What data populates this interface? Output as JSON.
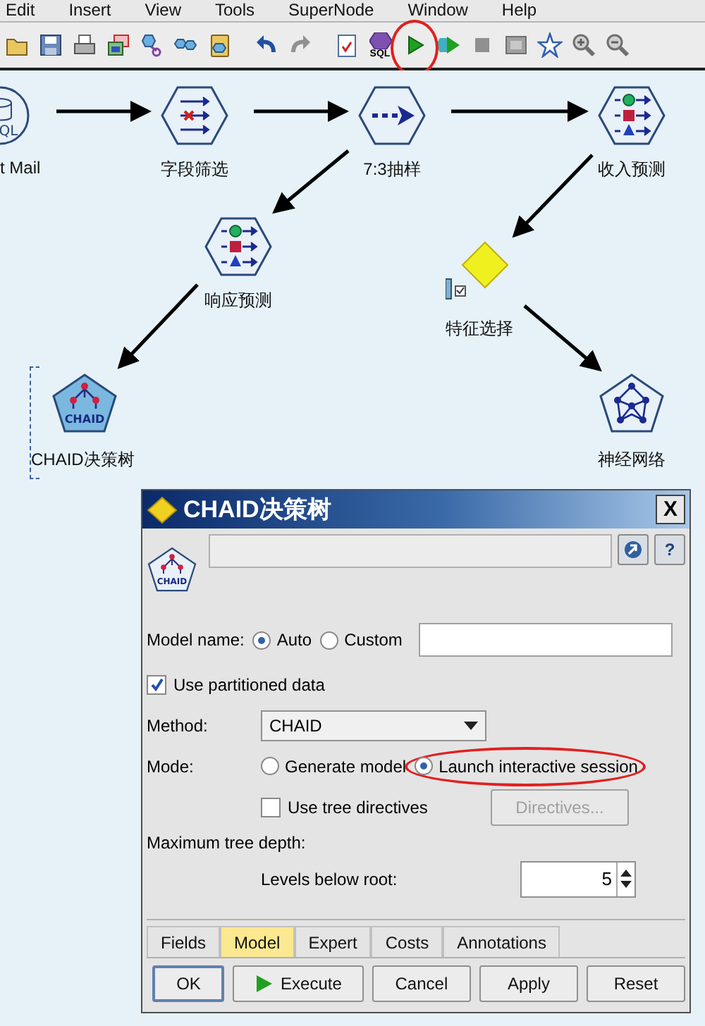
{
  "menu": [
    {
      "label": "Edit"
    },
    {
      "label": "Insert"
    },
    {
      "label": "View"
    },
    {
      "label": "Tools"
    },
    {
      "label": "SuperNode"
    },
    {
      "label": "Window"
    },
    {
      "label": "Help"
    }
  ],
  "toolbar": {
    "sql_label": "SQL"
  },
  "nodes": [
    {
      "kind": "source",
      "label": "t Mail",
      "icon_text": "QL",
      "selected": false
    },
    {
      "kind": "filter",
      "label": "字段筛选",
      "selected": false
    },
    {
      "kind": "sample",
      "label": "7:3抽样",
      "selected": false
    },
    {
      "kind": "model",
      "label": "收入预测",
      "selected": false
    },
    {
      "kind": "model",
      "label": "响应预测",
      "selected": false
    },
    {
      "kind": "feature",
      "label": "特征选择",
      "selected": false
    },
    {
      "kind": "chaid",
      "label": "CHAID决策树",
      "icon_text": "CHAID",
      "selected": true
    },
    {
      "kind": "neural",
      "label": "神经网络",
      "selected": false
    }
  ],
  "dialog": {
    "title": "CHAID决策树",
    "close_label": "X",
    "icon_text": "CHAID",
    "help_label": "?",
    "model_name": {
      "label": "Model name:",
      "options": [
        {
          "label": "Auto",
          "selected": true
        },
        {
          "label": "Custom",
          "selected": false
        }
      ]
    },
    "partitioned": {
      "label": "Use partitioned data",
      "checked": true
    },
    "method": {
      "label": "Method:",
      "value": "CHAID"
    },
    "mode": {
      "label": "Mode:",
      "options": [
        {
          "label": "Generate model",
          "selected": false
        },
        {
          "label": "Launch interactive session",
          "selected": true
        }
      ]
    },
    "tree_directives": {
      "label": "Use tree directives",
      "checked": false
    },
    "directives_button": {
      "label": "Directives...",
      "disabled": true
    },
    "max_depth_label": "Maximum tree depth:",
    "levels": {
      "label": "Levels below root:",
      "value": "5"
    },
    "tabs": [
      {
        "label": "Fields",
        "selected": false
      },
      {
        "label": "Model",
        "selected": true
      },
      {
        "label": "Expert",
        "selected": false
      },
      {
        "label": "Costs",
        "selected": false
      },
      {
        "label": "Annotations",
        "selected": false
      }
    ],
    "buttons": [
      {
        "label": "OK",
        "kind": "default"
      },
      {
        "label": "Execute",
        "kind": "run"
      },
      {
        "label": "Cancel",
        "kind": "plain"
      },
      {
        "label": "Apply",
        "kind": "plain"
      },
      {
        "label": "Reset",
        "kind": "plain"
      }
    ]
  }
}
